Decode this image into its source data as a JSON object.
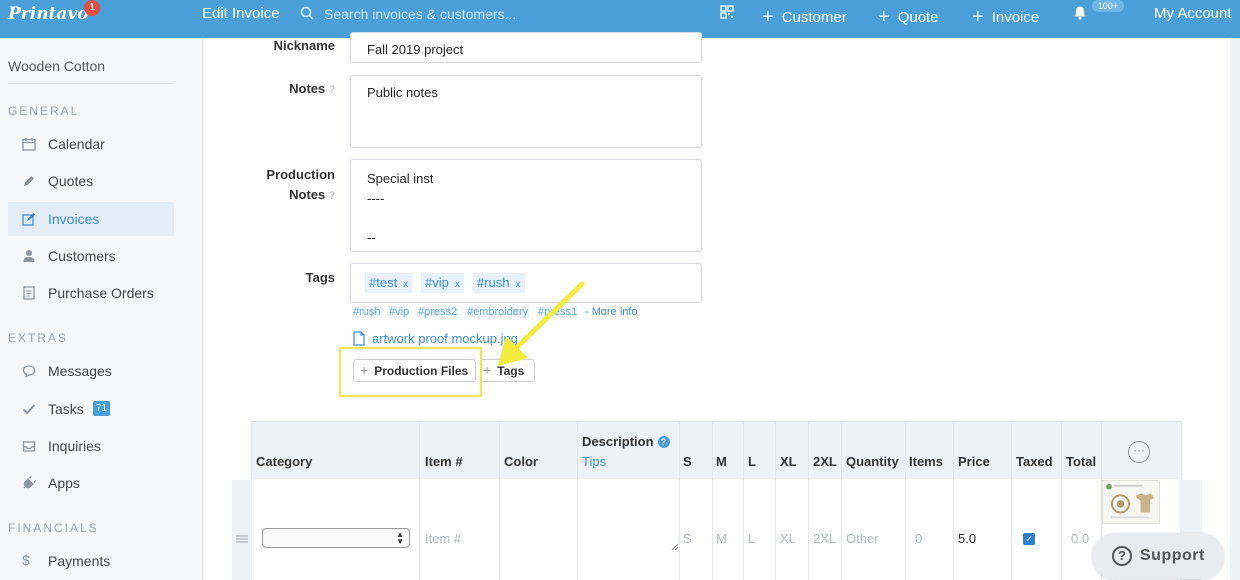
{
  "topbar": {
    "logo": "Printavo",
    "logo_badge": "1",
    "title": "Edit Invoice",
    "search_placeholder": "Search invoices & customers...",
    "new_customer": "Customer",
    "new_quote": "Quote",
    "new_invoice": "Invoice",
    "notif_badge": "100+",
    "account": "My Account"
  },
  "sidebar": {
    "company": "Wooden Cotton",
    "sections": {
      "general": "GENERAL",
      "extras": "EXTRAS",
      "financials": "FINANCIALS"
    },
    "general_items": [
      {
        "label": "Calendar",
        "icon": "calendar-icon"
      },
      {
        "label": "Quotes",
        "icon": "pencil-icon"
      },
      {
        "label": "Invoices",
        "icon": "edit-icon",
        "active": true
      },
      {
        "label": "Customers",
        "icon": "user-icon"
      },
      {
        "label": "Purchase Orders",
        "icon": "document-icon"
      }
    ],
    "extras_items": [
      {
        "label": "Messages",
        "icon": "chat-icon"
      },
      {
        "label": "Tasks",
        "icon": "check-icon",
        "badge": "71"
      },
      {
        "label": "Inquiries",
        "icon": "inbox-icon"
      },
      {
        "label": "Apps",
        "icon": "plug-icon"
      }
    ],
    "financials_items": [
      {
        "label": "Payments",
        "icon": "dollar-icon"
      }
    ]
  },
  "form": {
    "nickname_label": "Nickname",
    "nickname_value": "Fall 2019 project",
    "notes_label": "Notes",
    "notes_help": "?",
    "notes_value": "Public notes",
    "prod_notes_label_1": "Production",
    "prod_notes_label_2": "Notes",
    "prod_notes_help": "?",
    "prod_notes_lines": [
      "Special inst",
      "----",
      "",
      "--"
    ],
    "tags_label": "Tags",
    "tags": [
      "#test",
      "#vip",
      "#rush"
    ],
    "tag_remove": "x",
    "tag_suggestions": [
      "#rush",
      "#vip",
      "#press2",
      "#embroidery",
      "#press1"
    ],
    "more_info": "- More info",
    "file_name": "artwork proof mockup.jpg",
    "btn_production_files": "Production Files",
    "btn_tags": "Tags"
  },
  "table": {
    "headers": {
      "category": "Category",
      "item": "Item #",
      "color": "Color",
      "description": "Description",
      "tips": "Tips",
      "s": "S",
      "m": "M",
      "l": "L",
      "xl": "XL",
      "xxl": "2XL",
      "quantity": "Quantity",
      "items": "Items",
      "price": "Price",
      "taxed": "Taxed",
      "total": "Total"
    },
    "row": {
      "item_placeholder": "Item #",
      "s": "S",
      "m": "M",
      "l": "L",
      "xl": "XL",
      "xxl": "2XL",
      "quantity": "Other",
      "items": "0",
      "price": "5.0",
      "taxed": true,
      "total": "0.0"
    }
  },
  "support": {
    "label": "Support"
  },
  "colors": {
    "topbar": "#4a9fd8",
    "link": "#3d8ed3",
    "highlight": "#f2e84a"
  }
}
